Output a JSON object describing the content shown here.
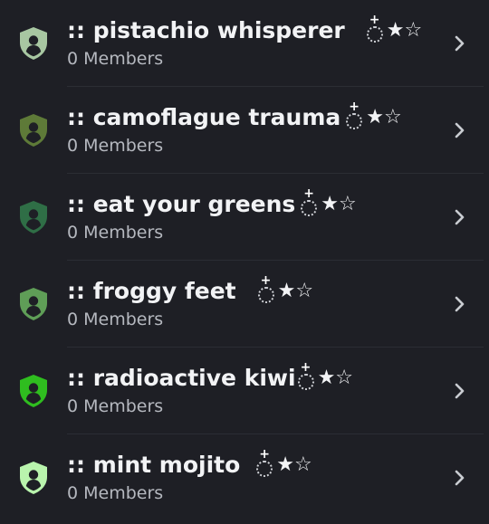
{
  "roles": [
    {
      "name": ":: pistachio whisperer",
      "deco_stars": "★☆",
      "members": "0 Members",
      "color": "#a8c7a2",
      "gap": 24
    },
    {
      "name": ":: camoflague trauma",
      "deco_stars": "★☆",
      "members": "0 Members",
      "color": "#5e7a38",
      "gap": 6
    },
    {
      "name": ":: eat your greens",
      "deco_stars": "★☆",
      "members": "0 Members",
      "color": "#2f6e46",
      "gap": 6
    },
    {
      "name": ":: froggy feet",
      "deco_stars": "★☆",
      "members": "0 Members",
      "color": "#5f9e57",
      "gap": 24
    },
    {
      "name": ":: radioactive kiwi",
      "deco_stars": "★☆",
      "members": "0 Members",
      "color": "#2fbd1f",
      "gap": 2
    },
    {
      "name": ":: mint mojito",
      "deco_stars": "★☆",
      "members": "0 Members",
      "color": "#b9f4ad",
      "gap": 18
    }
  ],
  "icons": {
    "role": "shield-person-icon",
    "open": "chevron-right-icon",
    "decoration": "dotted-ring-sparkle-icon"
  },
  "colors": {
    "background": "#1e1f25",
    "divider": "#2b2d34",
    "title": "#f2f3f5",
    "subtitle": "#b5b8bf",
    "chevron": "#c9ccd1"
  }
}
